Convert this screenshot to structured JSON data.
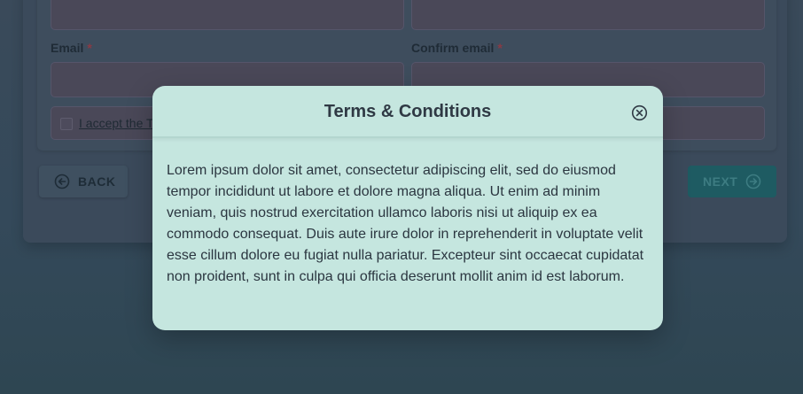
{
  "form": {
    "email_label": "Email",
    "confirm_email_label": "Confirm email",
    "required_mark": "*",
    "terms_text": "I accept the T"
  },
  "nav": {
    "back_label": "BACK",
    "next_label": "NEXT"
  },
  "modal": {
    "title": "Terms & Conditions",
    "body": "Lorem ipsum dolor sit amet, consectetur adipiscing elit, sed do eiusmod tempor incididunt ut labore et dolore magna aliqua. Ut enim ad minim veniam, quis nostrud exercitation ullamco laboris nisi ut aliquip ex ea commodo consequat. Duis aute irure dolor in reprehenderit in voluptate velit esse cillum dolore eu fugiat nulla pariatur. Excepteur sint occaecat cupidatat non proident, sunt in culpa qui officia deserunt mollit anim id est laborum."
  },
  "icons": {
    "back": "arrow-left-circle-icon",
    "next": "arrow-right-circle-icon",
    "close": "close-circle-icon"
  },
  "colors": {
    "modal_background": "#c5e6df",
    "next_button": "#1e5b62",
    "required": "#8a3a44",
    "overlay": "#34495a"
  }
}
